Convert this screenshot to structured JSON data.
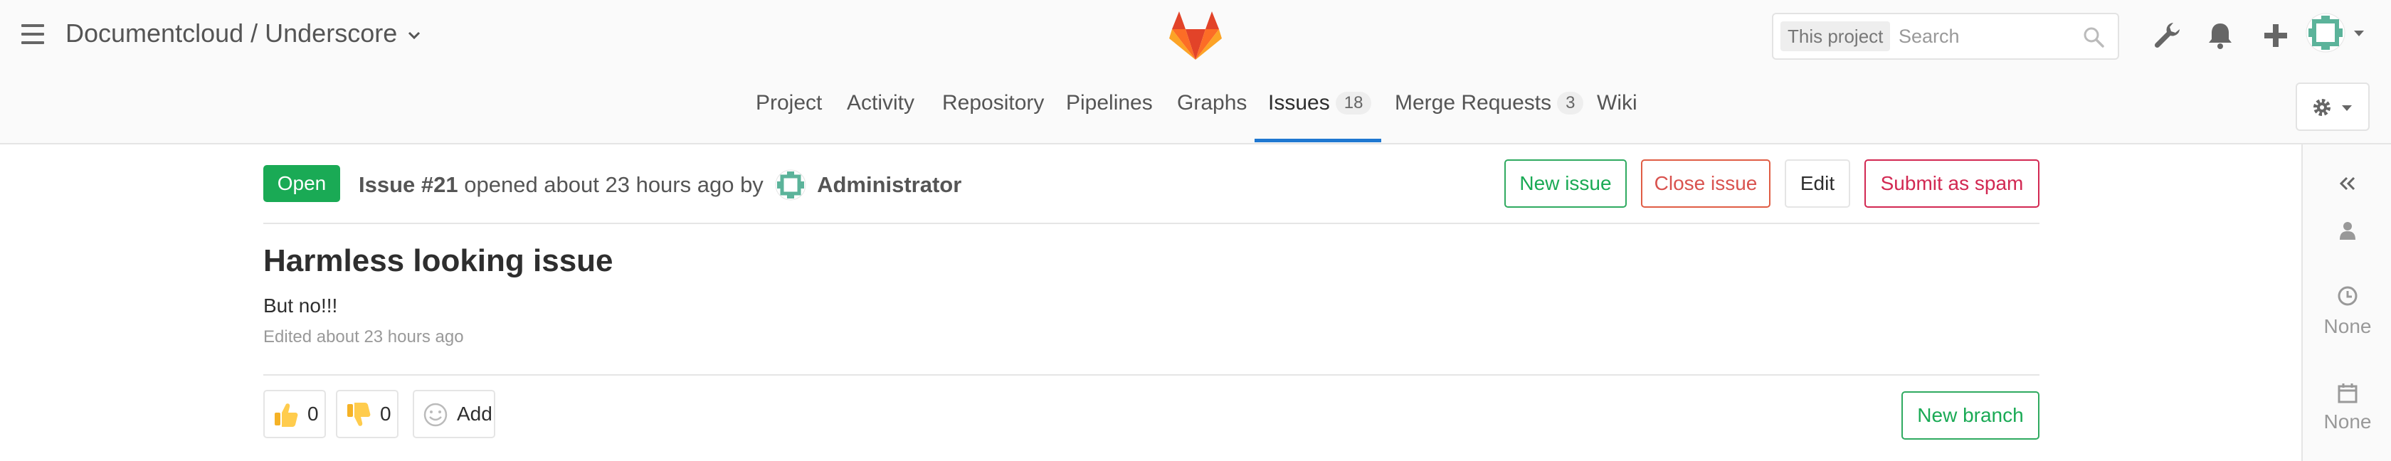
{
  "header": {
    "project_title": "Documentcloud / Underscore",
    "search": {
      "scope": "This project",
      "placeholder": "Search"
    },
    "icons": [
      "menu-icon",
      "chevron-down-icon",
      "gitlab-logo",
      "search-icon",
      "wrench-icon",
      "bell-icon",
      "plus-icon",
      "user-avatar",
      "caret-down-icon"
    ]
  },
  "tabs": [
    {
      "label": "Project"
    },
    {
      "label": "Activity"
    },
    {
      "label": "Repository"
    },
    {
      "label": "Pipelines"
    },
    {
      "label": "Graphs"
    },
    {
      "label": "Issues",
      "count": "18",
      "active": true
    },
    {
      "label": "Merge Requests",
      "count": "3"
    },
    {
      "label": "Wiki"
    }
  ],
  "issue": {
    "status": "Open",
    "number": "Issue #21",
    "opened_text": "opened about 23 hours ago by",
    "author": "Administrator",
    "title": "Harmless looking issue",
    "description": "But no!!!",
    "edited": "Edited about 23 hours ago"
  },
  "actions": {
    "new_issue": "New issue",
    "close_issue": "Close issue",
    "edit": "Edit",
    "submit_spam": "Submit as spam",
    "new_branch": "New branch"
  },
  "awards": {
    "thumbs_up": "0",
    "thumbs_down": "0",
    "add": "Add"
  },
  "sidebar": {
    "milestone": "None",
    "due_date": "None"
  },
  "colors": {
    "green": "#1aaa55",
    "red": "#d22852",
    "tab_underline": "#1f78d1",
    "header_bg": "#fafafa"
  }
}
